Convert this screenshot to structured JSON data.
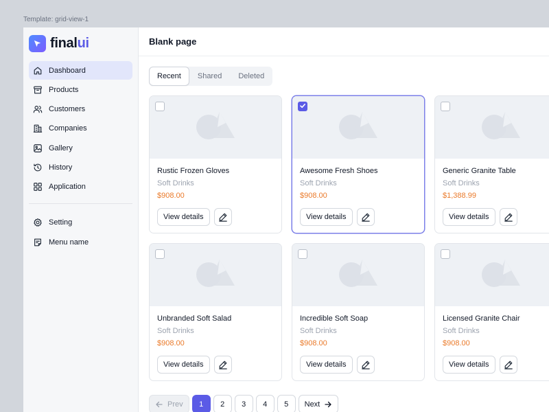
{
  "template_label": "Template: grid-view-1",
  "brand": {
    "name_part1": "final",
    "name_part2": "ui"
  },
  "sidebar": {
    "items": [
      {
        "label": "Dashboard",
        "icon": "home-icon",
        "active": true
      },
      {
        "label": "Products",
        "icon": "archive-icon"
      },
      {
        "label": "Customers",
        "icon": "users-icon"
      },
      {
        "label": "Companies",
        "icon": "building-icon"
      },
      {
        "label": "Gallery",
        "icon": "image-icon"
      },
      {
        "label": "History",
        "icon": "history-icon"
      },
      {
        "label": "Application",
        "icon": "grid-icon"
      }
    ],
    "bottom_items": [
      {
        "label": "Setting",
        "icon": "gear-icon"
      },
      {
        "label": "Menu name",
        "icon": "note-icon"
      }
    ]
  },
  "header": {
    "title": "Blank page"
  },
  "tabs": [
    {
      "label": "Recent",
      "active": true
    },
    {
      "label": "Shared"
    },
    {
      "label": "Deleted"
    }
  ],
  "products": [
    {
      "name": "Rustic Frozen Gloves",
      "category": "Soft Drinks",
      "price": "$908.00",
      "selected": false
    },
    {
      "name": "Awesome Fresh Shoes",
      "category": "Soft Drinks",
      "price": "$908.00",
      "selected": true
    },
    {
      "name": "Generic Granite Table",
      "category": "Soft Drinks",
      "price": "$1,388.99",
      "selected": false
    },
    {
      "name": "Unbranded Soft Salad",
      "category": "Soft Drinks",
      "price": "$908.00",
      "selected": false
    },
    {
      "name": "Incredible Soft Soap",
      "category": "Soft Drinks",
      "price": "$908.00",
      "selected": false
    },
    {
      "name": "Licensed Granite Chair",
      "category": "Soft Drinks",
      "price": "$908.00",
      "selected": false
    }
  ],
  "card_button_label": "View details",
  "pagination": {
    "prev_label": "Prev",
    "next_label": "Next",
    "pages": [
      "1",
      "2",
      "3",
      "4",
      "5"
    ],
    "current": "1"
  },
  "colors": {
    "accent": "#5b5be6",
    "price": "#ea7a2a",
    "active_nav": "#e2e6fb"
  }
}
